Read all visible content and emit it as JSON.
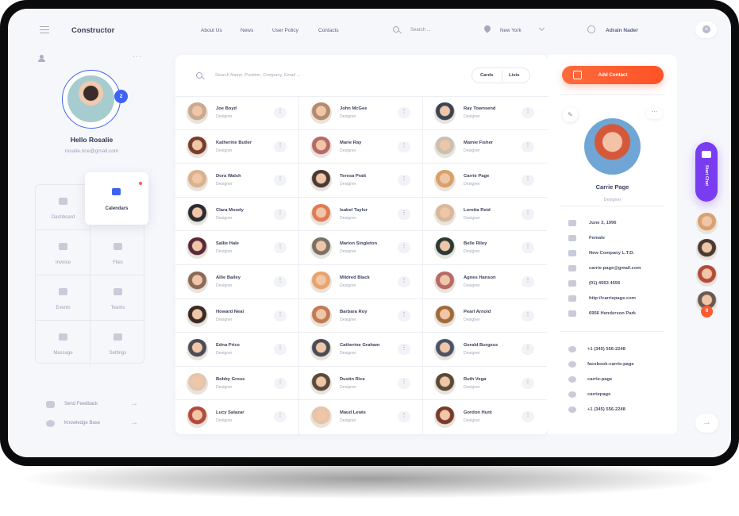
{
  "app": {
    "brand": "Constructor"
  },
  "topnav": {
    "items": [
      "About Us",
      "News",
      "User Policy",
      "Contacts"
    ],
    "search_placeholder": "Search ...",
    "location": "New York",
    "user_name": "Adrain Nader"
  },
  "profile": {
    "greeting": "Hello Rosalie",
    "email": "rosalie.rice@gmail.com",
    "notification_count": "2"
  },
  "menu": [
    {
      "label": "Dashboard",
      "icon": "dashboard-icon",
      "active": false
    },
    {
      "label": "Calendars",
      "icon": "people-icon",
      "active": true
    },
    {
      "label": "Invoice",
      "icon": "document-icon",
      "active": false
    },
    {
      "label": "Files",
      "icon": "cloud-icon",
      "active": false
    },
    {
      "label": "Events",
      "icon": "thumbs-icon",
      "active": false
    },
    {
      "label": "Teams",
      "icon": "people-icon",
      "active": false
    },
    {
      "label": "Massage",
      "icon": "chat-icon",
      "active": false
    },
    {
      "label": "Settings",
      "icon": "wrench-icon",
      "active": false
    }
  ],
  "help": [
    {
      "label": "Send Feedback"
    },
    {
      "label": "Knowledge  Base"
    }
  ],
  "contacts": {
    "search_placeholder": "Search Name, Position, Company, Email ...",
    "view_cards": "Cards",
    "view_lists": "Lists",
    "columns": [
      [
        {
          "name": "Joe Boyd",
          "role": "Designer",
          "color": "#c9a98f"
        },
        {
          "name": "Katherine Butler",
          "role": "Designer",
          "color": "#7a3d2c"
        },
        {
          "name": "Dora Walsh",
          "role": "Designer",
          "color": "#d8b28c"
        },
        {
          "name": "Clara Moody",
          "role": "Designer",
          "color": "#2b2b33"
        },
        {
          "name": "Sallie Hale",
          "role": "Designer",
          "color": "#5a2a3a"
        },
        {
          "name": "Allie Bailey",
          "role": "Designer",
          "color": "#8a6a55"
        },
        {
          "name": "Howard Neal",
          "role": "Designer",
          "color": "#3a2a24"
        },
        {
          "name": "Edna Price",
          "role": "Designer",
          "color": "#4a4c56"
        },
        {
          "name": "Bobby Gross",
          "role": "Designer",
          "color": "#e4c6b0"
        },
        {
          "name": "Lucy Salazar",
          "role": "Designer",
          "color": "#b54a3a"
        }
      ],
      [
        {
          "name": "John McGee",
          "role": "Designer",
          "color": "#b58a6a"
        },
        {
          "name": "Marie Ray",
          "role": "Designer",
          "color": "#b56a66"
        },
        {
          "name": "Teresa Pratt",
          "role": "Designer",
          "color": "#4a3a34"
        },
        {
          "name": "Isabel Taylor",
          "role": "Designer",
          "color": "#e27a55"
        },
        {
          "name": "Marion Singleton",
          "role": "Designer",
          "color": "#7a7268"
        },
        {
          "name": "Mildred Black",
          "role": "Designer",
          "color": "#e8a46a"
        },
        {
          "name": "Barbara Roy",
          "role": "Designer",
          "color": "#c27a55"
        },
        {
          "name": "Catherine Graham",
          "role": "Designer",
          "color": "#4a4c56"
        },
        {
          "name": "Dustin Rice",
          "role": "Designer",
          "color": "#5a4a3a"
        },
        {
          "name": "Maud Lewis",
          "role": "Designer",
          "color": "#e8c4a8"
        }
      ],
      [
        {
          "name": "Ray Townsend",
          "role": "Designer",
          "color": "#3a4454"
        },
        {
          "name": "Mamie Fisher",
          "role": "Designer",
          "color": "#c9c0b2"
        },
        {
          "name": "Carrie Page",
          "role": "Designer",
          "color": "#d9a06a"
        },
        {
          "name": "Loretta Reid",
          "role": "Designer",
          "color": "#d8b89a"
        },
        {
          "name": "Belle Riley",
          "role": "Designer",
          "color": "#2a3a36"
        },
        {
          "name": "Agnes Hanson",
          "role": "Designer",
          "color": "#b56a66"
        },
        {
          "name": "Pearl Arnold",
          "role": "Designer",
          "color": "#a06a3a"
        },
        {
          "name": "Gerald Burgess",
          "role": "Designer",
          "color": "#4a5466"
        },
        {
          "name": "Ruth Vega",
          "role": "Designer",
          "color": "#5a4a36"
        },
        {
          "name": "Gordon Hunt",
          "role": "Designer",
          "color": "#7a3a2a"
        }
      ]
    ]
  },
  "detail": {
    "add_label": "Add Contact",
    "name": "Carrie Page",
    "role": "Designer",
    "info": [
      {
        "icon": "cake-icon",
        "text": "June 3, 1996"
      },
      {
        "icon": "person-icon",
        "text": "Female"
      },
      {
        "icon": "building-icon",
        "text": "New Company  L.T.D."
      },
      {
        "icon": "mail-icon",
        "text": "carrie-page@gmail.com"
      },
      {
        "icon": "phone-icon",
        "text": "(01) 4563 4556"
      },
      {
        "icon": "share-icon",
        "text": "http://carriepage.com"
      },
      {
        "icon": "flag-icon",
        "text": "6956 Henderson Park"
      }
    ],
    "social": [
      {
        "icon": "messenger-icon",
        "text": "+1 (345) 556-2248"
      },
      {
        "icon": "facebook-icon",
        "text": "facebook-carrie-page"
      },
      {
        "icon": "skype-icon",
        "text": "carrie-page"
      },
      {
        "icon": "telegram-icon",
        "text": "carriepage"
      },
      {
        "icon": "whatsapp-icon",
        "text": "+1 (345) 556-2248"
      }
    ]
  },
  "chat": {
    "label": "Start Chat",
    "badge": "8",
    "avatars": [
      "#d9a070",
      "#4a3a30",
      "#b54a3a",
      "#6a5a50"
    ]
  },
  "colors": {
    "accent_blue": "#3e63f3",
    "accent_orange": "#ff5b30",
    "accent_purple": "#7a3cf0"
  }
}
